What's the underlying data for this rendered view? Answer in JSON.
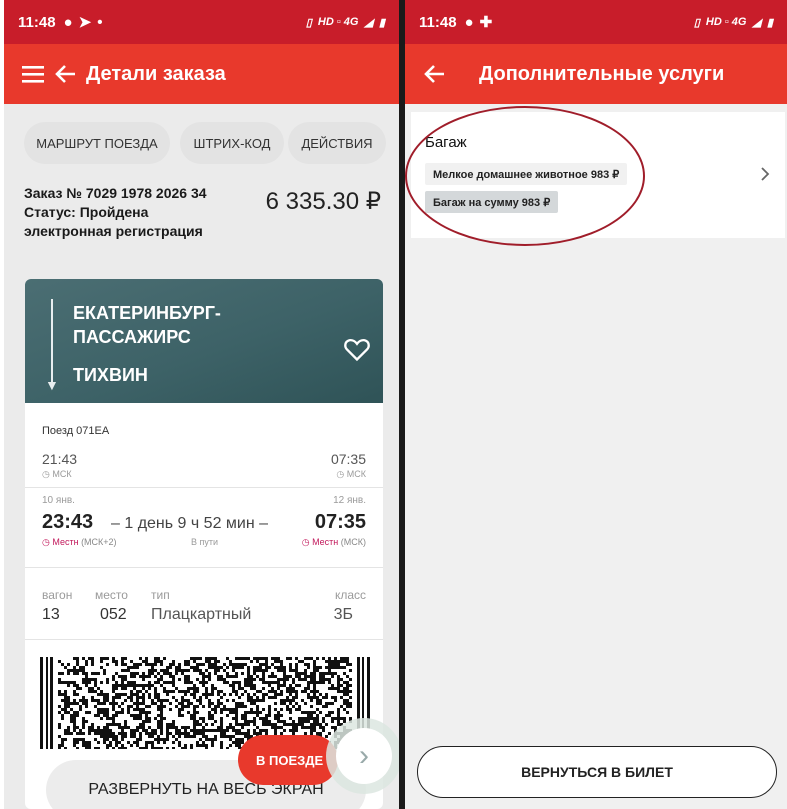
{
  "left": {
    "status": {
      "time": "11:48",
      "net": "HD ▫ 4G"
    },
    "appbar": {
      "title": "Детали заказа"
    },
    "chips": [
      "МАРШРУТ ПОЕЗДА",
      "ШТРИХ-КОД",
      "ДЕЙСТВИЯ"
    ],
    "order": {
      "number": "Заказ № 7029 1978 2026 34",
      "status": "Статус: Пройдена",
      "status2": "электронная регистрация",
      "price": "6 335.30 ₽"
    },
    "route": {
      "from": "ЕКАТЕРИНБУРГ-ПАССАЖИРС",
      "to": "ТИХВИН"
    },
    "train": "Поезд 071ЕА",
    "moscow": {
      "dep_time": "21:43",
      "dep_zone": "МСК",
      "arr_time": "07:35",
      "arr_zone": "МСК"
    },
    "local": {
      "dep_date": "10 янв.",
      "dep_time": "23:43",
      "dep_zone": "Местн",
      "dep_zone_suffix": " (МСК+2)",
      "duration": "1 день 9 ч 52 мин",
      "duration_label": "В пути",
      "arr_date": "12 янв.",
      "arr_time": "07:35",
      "arr_zone": "Местн",
      "arr_zone_suffix": " (МСК)"
    },
    "seat": {
      "wagon_label": "вагон",
      "wagon": "13",
      "place_label": "место",
      "place": "052",
      "type_label": "тип",
      "type": "Плацкартный",
      "class_label": "класс",
      "class": "3Б"
    },
    "train_button": "В ПОЕЗДЕ",
    "expand_button": "РАЗВЕРНУТЬ НА ВЕСЬ ЭКРАН"
  },
  "right": {
    "status": {
      "time": "11:48",
      "net": "HD ▫ 4G"
    },
    "appbar": {
      "title": "Дополнительные услуги"
    },
    "section": "Багаж",
    "item": "Мелкое домашнее животное 983 ₽",
    "summary": "Багаж на сумму 983 ₽",
    "back_button": "ВЕРНУТЬСЯ В БИЛЕТ"
  },
  "colors": {
    "statusbar": "#c81d2a",
    "appbar": "#e8392c",
    "accent": "#e8392c",
    "local_time": "#c2185b"
  }
}
